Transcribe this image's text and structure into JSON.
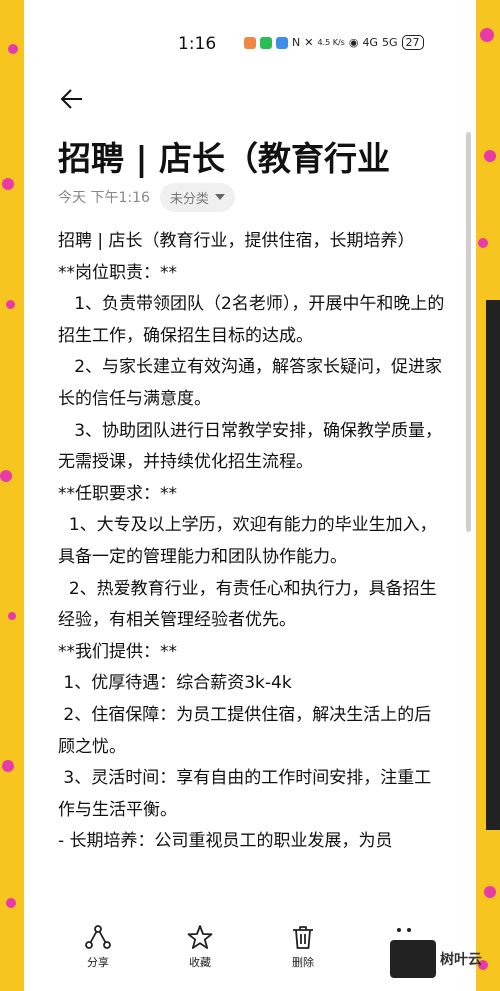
{
  "status": {
    "time": "1:16",
    "speed": "4.5\nK/s",
    "signal1": "4G",
    "signal2": "5G",
    "battery": "27"
  },
  "header": {
    "title": "招聘 | 店长（教育行业",
    "date": "今天 下午1:16",
    "category": "未分类"
  },
  "content": [
    "招聘 | 店长（教育行业，提供住宿，长期培养）",
    "**岗位职责：**",
    "   1、负责带领团队（2名老师），开展中午和晚上的招生工作，确保招生目标的达成。",
    "   2、与家长建立有效沟通，解答家长疑问，促进家长的信任与满意度。",
    "   3、协助团队进行日常教学安排，确保教学质量，无需授课，并持续优化招生流程。",
    "**任职要求：**",
    "  1、大专及以上学历，欢迎有能力的毕业生加入，具备一定的管理能力和团队协作能力。",
    "  2、热爱教育行业，有责任心和执行力，具备招生经验，有相关管理经验者优先。",
    "**我们提供：**",
    " 1、优厚待遇：综合薪资3k-4k",
    " 2、住宿保障：为员工提供住宿，解决生活上的后顾之忧。",
    " 3、灵活时间：享有自由的工作时间安排，注重工作与生活平衡。",
    "- 长期培养：公司重视员工的职业发展，为员"
  ],
  "toolbar": {
    "share": "分享",
    "favorite": "收藏",
    "delete": "删除",
    "more": "更多"
  },
  "watermark": "树叶云",
  "colors": {
    "background": "#f7c520",
    "dots": "#e83aa8"
  }
}
